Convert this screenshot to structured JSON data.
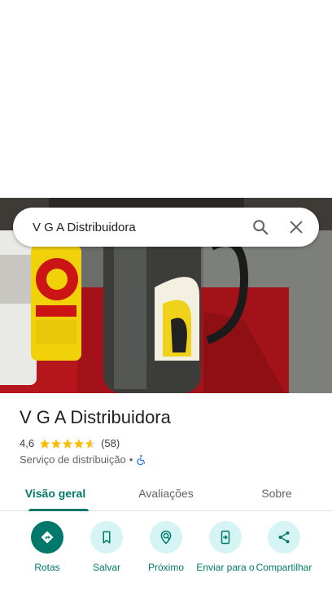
{
  "search": {
    "query": "V G A Distribuidora"
  },
  "place": {
    "name": "V G A Distribuidora",
    "rating": "4,6",
    "review_count": "(58)",
    "stars_value": 4.6,
    "category": "Serviço de distribuição",
    "separator": "•"
  },
  "tabs": [
    {
      "label": "Visão geral",
      "active": true
    },
    {
      "label": "Avaliações",
      "active": false
    },
    {
      "label": "Sobre",
      "active": false
    }
  ],
  "actions": [
    {
      "label": "Rotas",
      "icon": "directions-icon"
    },
    {
      "label": "Salvar",
      "icon": "bookmark-icon"
    },
    {
      "label": "Próximo",
      "icon": "nearby-icon"
    },
    {
      "label": "Enviar para o",
      "icon": "send-to-phone-icon"
    },
    {
      "label": "Compartilhar",
      "icon": "share-icon"
    }
  ],
  "colors": {
    "accent": "#00796b",
    "star": "#fbbc04",
    "chip_bg": "#d6f4f3"
  }
}
